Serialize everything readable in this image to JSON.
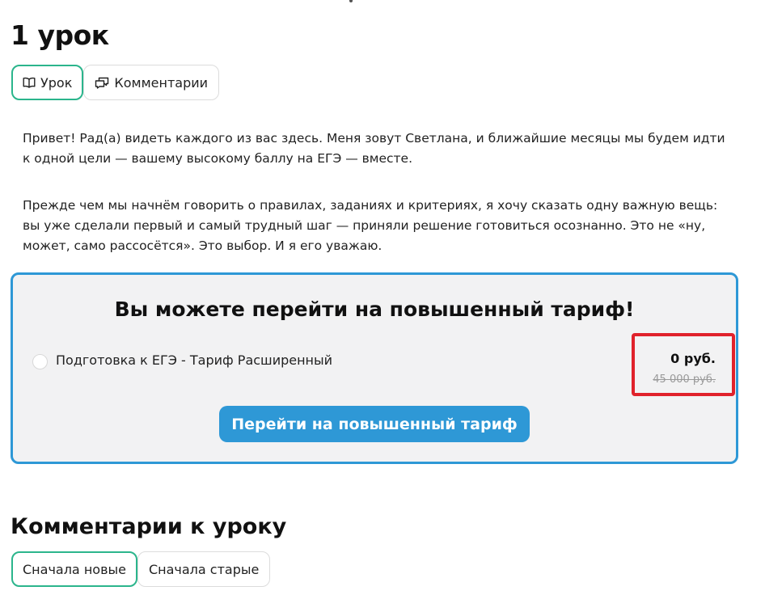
{
  "lesson": {
    "title": "1 урок",
    "tabs": [
      {
        "label": "Урок",
        "icon": "book-icon",
        "active": true
      },
      {
        "label": "Комментарии",
        "icon": "comments-icon",
        "active": false
      }
    ],
    "paragraphs": [
      "Привет! Рад(а) видеть каждого из вас здесь. Меня зовут Светлана, и ближайшие месяцы мы будем идти к одной цели — вашему высокому баллу на ЕГЭ — вместе.",
      "Прежде чем мы начнём говорить о правилах, заданиях и критериях, я хочу сказать одну важную вещь: вы уже сделали первый и самый трудный шаг — приняли решение готовиться осознанно. Это не «ну, может, само рассосётся». Это выбор. И я его уважаю."
    ]
  },
  "upgrade": {
    "title": "Вы можете перейти на повышенный тариф!",
    "tariff_name": "Подготовка к ЕГЭ - Тариф Расширенный",
    "price_current": "0 руб.",
    "price_old": "45 000 руб.",
    "button_label": "Перейти на повышенный тариф"
  },
  "comments": {
    "title": "Комментарии к уроку",
    "sort_options": [
      {
        "label": "Сначала новые",
        "active": true
      },
      {
        "label": "Сначала старые",
        "active": false
      }
    ]
  },
  "colors": {
    "accent_green": "#2bb58c",
    "accent_blue": "#2e98d6",
    "highlight_red": "#e0222b"
  }
}
